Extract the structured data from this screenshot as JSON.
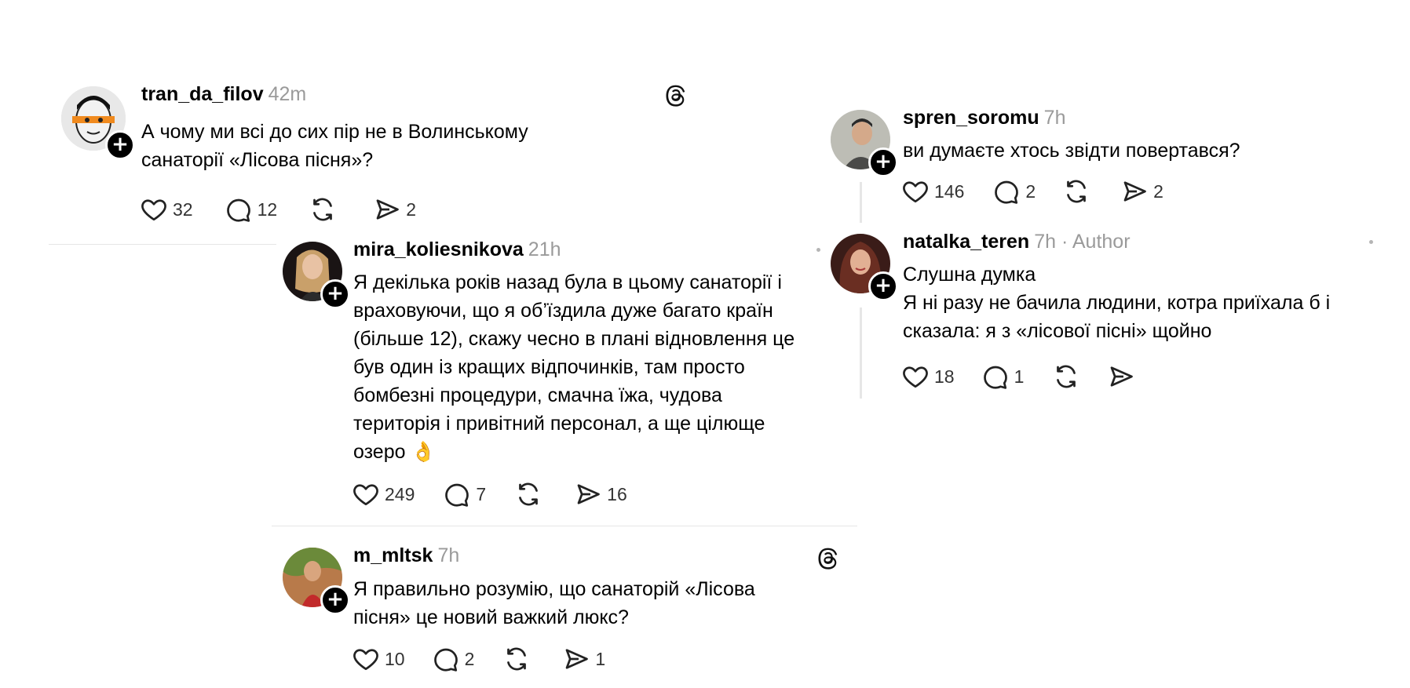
{
  "posts": [
    {
      "username": "tran_da_filov",
      "time": "42m",
      "text": [
        "А чому ми всі до сих пір не в Волинському",
        "санаторії «Лісова пісня»?"
      ],
      "likes": "32",
      "replies": "12",
      "shares": "2",
      "avatar_color": "#cfcfcf"
    },
    {
      "username": "mira_koliesnikova",
      "time": "21h",
      "text": [
        "Я декілька років назад була в цьому санаторії і",
        "враховуючи, що я об’їздила дуже багато країн",
        "(більше 12), скажу чесно в плані відновлення це",
        "був один із кращих відпочинків, там просто",
        "бомбезні процедури, смачна їжа, чудова",
        "територія і привітний персонал, а ще цілюще",
        "озеро 👌"
      ],
      "likes": "249",
      "replies": "7",
      "shares": "16",
      "avatar_color": "#2a2020"
    },
    {
      "username": "m_mltsk",
      "time": "7h",
      "text": [
        "Я правильно розумію, що санаторій «Лісова",
        "пісня» це новий важкий люкс?"
      ],
      "likes": "10",
      "replies": "2",
      "shares": "1",
      "avatar_color": "#8a4a2a"
    },
    {
      "username": "spren_soromu",
      "time": "7h",
      "text": [
        "ви думаєте хтось звідти повертався?"
      ],
      "likes": "146",
      "replies": "2",
      "shares": "2",
      "avatar_color": "#7a7a72"
    },
    {
      "username": "natalka_teren",
      "time": "7h",
      "author": "· Author",
      "text": [
        "Слушна думка",
        "Я ні разу не бачила людини, котра приїхала б і",
        "сказала: я з «лісової пісні» щойно"
      ],
      "likes": "18",
      "replies": "1",
      "shares": "",
      "avatar_color": "#5a2a20"
    }
  ]
}
